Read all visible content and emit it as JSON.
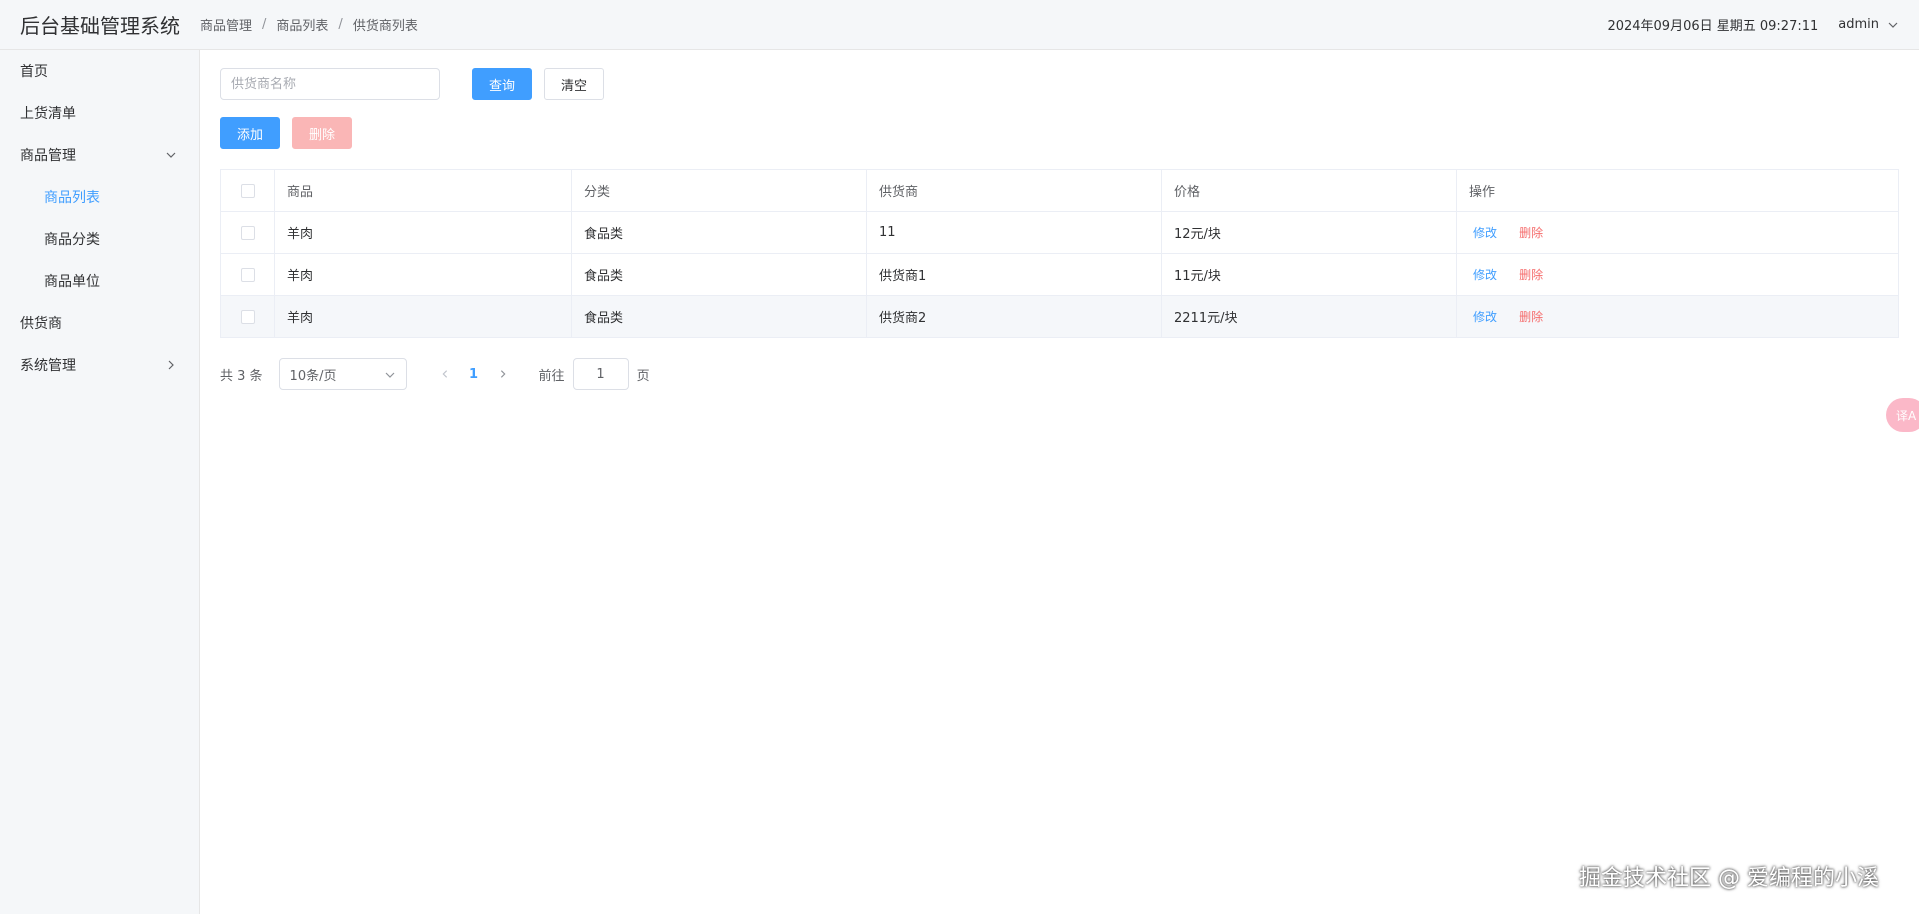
{
  "app": {
    "title": "后台基础管理系统"
  },
  "breadcrumb": [
    "商品管理",
    "商品列表",
    "供货商列表"
  ],
  "header": {
    "datetime": "2024年09月06日 星期五 09:27:11",
    "user": "admin"
  },
  "sidebar": {
    "items": [
      {
        "label": "首页"
      },
      {
        "label": "上货清单"
      },
      {
        "label": "商品管理"
      },
      {
        "label": "商品列表"
      },
      {
        "label": "商品分类"
      },
      {
        "label": "商品单位"
      },
      {
        "label": "供货商"
      },
      {
        "label": "系统管理"
      }
    ]
  },
  "search": {
    "placeholder": "供货商名称",
    "query_label": "查询",
    "clear_label": "清空"
  },
  "actions": {
    "add_label": "添加",
    "delete_label": "删除"
  },
  "table": {
    "columns": [
      "商品",
      "分类",
      "供货商",
      "价格",
      "操作"
    ],
    "rows": [
      {
        "goods": "羊肉",
        "category": "食品类",
        "supplier": "11",
        "price": "12元/块"
      },
      {
        "goods": "羊肉",
        "category": "食品类",
        "supplier": "供货商1",
        "price": "11元/块"
      },
      {
        "goods": "羊肉",
        "category": "食品类",
        "supplier": "供货商2",
        "price": "2211元/块"
      }
    ],
    "edit_label": "修改",
    "delete_label": "删除"
  },
  "pagination": {
    "total_text": "共 3 条",
    "page_size": "10条/页",
    "current_page": "1",
    "goto_label": "前往",
    "goto_value": "1",
    "goto_suffix": "页"
  },
  "translate_badge": "译A",
  "watermark": "掘金技术社区 @ 爱编程的小溪"
}
